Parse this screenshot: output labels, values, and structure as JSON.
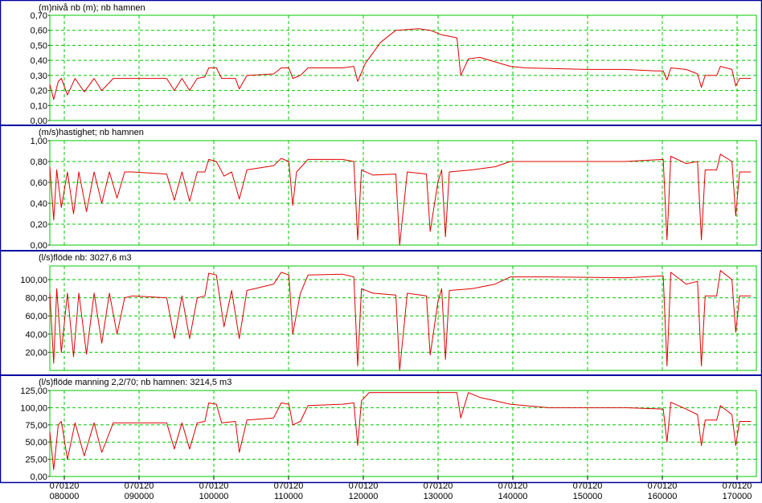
{
  "colors": {
    "frame": "#0000a0",
    "plot_border": "#00c800",
    "grid": "#00c800",
    "trace": "#e00000",
    "background": "#ffffff"
  },
  "time_axis": {
    "ticks": [
      {
        "date": "070120",
        "time": "080000"
      },
      {
        "date": "070120",
        "time": "090000"
      },
      {
        "date": "070120",
        "time": "100000"
      },
      {
        "date": "070120",
        "time": "110000"
      },
      {
        "date": "070120",
        "time": "120000"
      },
      {
        "date": "070120",
        "time": "130000"
      },
      {
        "date": "070120",
        "time": "140000"
      },
      {
        "date": "070120",
        "time": "150000"
      },
      {
        "date": "070120",
        "time": "160000"
      },
      {
        "date": "070120",
        "time": "170000"
      }
    ]
  },
  "chart_data": [
    {
      "type": "line",
      "title": "(m)nivå nb (m); nb hamnen",
      "ylim": [
        0,
        0.7
      ],
      "yticks": [
        "0,00",
        "0,10",
        "0,20",
        "0,30",
        "0,40",
        "0,50",
        "0,60",
        "0,70"
      ],
      "grid": true,
      "x_unit": "hour of day (070120)",
      "points": [
        [
          7.97,
          0.24
        ],
        [
          8.02,
          0.14
        ],
        [
          8.08,
          0.26
        ],
        [
          8.12,
          0.28
        ],
        [
          8.2,
          0.17
        ],
        [
          8.3,
          0.28
        ],
        [
          8.42,
          0.19
        ],
        [
          8.55,
          0.28
        ],
        [
          8.65,
          0.2
        ],
        [
          8.8,
          0.28
        ],
        [
          8.95,
          0.28
        ],
        [
          9.0,
          0.28
        ],
        [
          9.5,
          0.28
        ],
        [
          9.6,
          0.2
        ],
        [
          9.7,
          0.28
        ],
        [
          9.8,
          0.2
        ],
        [
          9.9,
          0.28
        ],
        [
          10.0,
          0.29
        ],
        [
          10.05,
          0.35
        ],
        [
          10.15,
          0.35
        ],
        [
          10.22,
          0.28
        ],
        [
          10.4,
          0.28
        ],
        [
          10.45,
          0.21
        ],
        [
          10.55,
          0.3
        ],
        [
          10.9,
          0.31
        ],
        [
          11.0,
          0.35
        ],
        [
          11.1,
          0.35
        ],
        [
          11.15,
          0.28
        ],
        [
          11.25,
          0.3
        ],
        [
          11.35,
          0.35
        ],
        [
          11.8,
          0.35
        ],
        [
          11.95,
          0.36
        ],
        [
          12.0,
          0.26
        ],
        [
          12.1,
          0.38
        ],
        [
          12.3,
          0.52
        ],
        [
          12.5,
          0.6
        ],
        [
          12.8,
          0.61
        ],
        [
          12.95,
          0.6
        ],
        [
          13.1,
          0.57
        ],
        [
          13.3,
          0.55
        ],
        [
          13.35,
          0.3
        ],
        [
          13.45,
          0.41
        ],
        [
          13.6,
          0.42
        ],
        [
          13.8,
          0.39
        ],
        [
          14.0,
          0.36
        ],
        [
          14.2,
          0.35
        ],
        [
          15.0,
          0.34
        ],
        [
          15.5,
          0.34
        ],
        [
          15.9,
          0.33
        ],
        [
          16.0,
          0.33
        ],
        [
          16.05,
          0.27
        ],
        [
          16.1,
          0.35
        ],
        [
          16.3,
          0.34
        ],
        [
          16.45,
          0.31
        ],
        [
          16.5,
          0.22
        ],
        [
          16.55,
          0.3
        ],
        [
          16.7,
          0.3
        ],
        [
          16.75,
          0.36
        ],
        [
          16.9,
          0.34
        ],
        [
          16.95,
          0.23
        ],
        [
          17.0,
          0.28
        ],
        [
          17.15,
          0.28
        ]
      ]
    },
    {
      "type": "line",
      "title": "(m/s)hastighet; nb hamnen",
      "ylim": [
        0,
        1.0
      ],
      "yticks": [
        "0,00",
        "0,20",
        "0,40",
        "0,60",
        "0,80",
        "1,00"
      ],
      "grid": true,
      "x_unit": "hour of day (070120)",
      "points": [
        [
          7.97,
          0.75
        ],
        [
          8.02,
          0.24
        ],
        [
          8.06,
          0.72
        ],
        [
          8.12,
          0.36
        ],
        [
          8.2,
          0.7
        ],
        [
          8.28,
          0.3
        ],
        [
          8.35,
          0.7
        ],
        [
          8.45,
          0.32
        ],
        [
          8.55,
          0.7
        ],
        [
          8.65,
          0.4
        ],
        [
          8.75,
          0.7
        ],
        [
          8.85,
          0.45
        ],
        [
          8.95,
          0.7
        ],
        [
          9.05,
          0.7
        ],
        [
          9.5,
          0.68
        ],
        [
          9.6,
          0.43
        ],
        [
          9.7,
          0.7
        ],
        [
          9.8,
          0.42
        ],
        [
          9.9,
          0.7
        ],
        [
          10.0,
          0.7
        ],
        [
          10.05,
          0.82
        ],
        [
          10.15,
          0.8
        ],
        [
          10.25,
          0.66
        ],
        [
          10.35,
          0.7
        ],
        [
          10.45,
          0.44
        ],
        [
          10.55,
          0.72
        ],
        [
          10.9,
          0.76
        ],
        [
          11.0,
          0.83
        ],
        [
          11.1,
          0.8
        ],
        [
          11.15,
          0.38
        ],
        [
          11.2,
          0.7
        ],
        [
          11.35,
          0.82
        ],
        [
          11.8,
          0.82
        ],
        [
          11.95,
          0.8
        ],
        [
          12.0,
          0.05
        ],
        [
          12.05,
          0.72
        ],
        [
          12.2,
          0.67
        ],
        [
          12.5,
          0.68
        ],
        [
          12.55,
          0.0
        ],
        [
          12.65,
          0.7
        ],
        [
          12.9,
          0.68
        ],
        [
          12.95,
          0.13
        ],
        [
          13.05,
          0.6
        ],
        [
          13.1,
          0.72
        ],
        [
          13.15,
          0.08
        ],
        [
          13.2,
          0.7
        ],
        [
          13.5,
          0.72
        ],
        [
          13.8,
          0.75
        ],
        [
          14.0,
          0.8
        ],
        [
          14.5,
          0.8
        ],
        [
          15.5,
          0.8
        ],
        [
          16.0,
          0.82
        ],
        [
          16.05,
          0.05
        ],
        [
          16.1,
          0.85
        ],
        [
          16.3,
          0.78
        ],
        [
          16.45,
          0.8
        ],
        [
          16.5,
          0.05
        ],
        [
          16.55,
          0.72
        ],
        [
          16.7,
          0.72
        ],
        [
          16.75,
          0.87
        ],
        [
          16.9,
          0.8
        ],
        [
          16.95,
          0.28
        ],
        [
          17.0,
          0.7
        ],
        [
          17.15,
          0.7
        ]
      ]
    },
    {
      "type": "line",
      "title": "(l/s)flöde nb: 3027,6 m3",
      "ylim": [
        0,
        115
      ],
      "yticks": [
        "20,00",
        "40,00",
        "60,00",
        "80,00",
        "100,00"
      ],
      "grid": true,
      "x_unit": "hour of day (070120)",
      "points": [
        [
          7.97,
          85
        ],
        [
          8.02,
          8
        ],
        [
          8.06,
          90
        ],
        [
          8.12,
          20
        ],
        [
          8.2,
          85
        ],
        [
          8.28,
          15
        ],
        [
          8.35,
          85
        ],
        [
          8.45,
          18
        ],
        [
          8.55,
          85
        ],
        [
          8.65,
          30
        ],
        [
          8.75,
          85
        ],
        [
          8.85,
          40
        ],
        [
          8.95,
          80
        ],
        [
          9.05,
          82
        ],
        [
          9.5,
          80
        ],
        [
          9.6,
          35
        ],
        [
          9.7,
          82
        ],
        [
          9.8,
          35
        ],
        [
          9.9,
          80
        ],
        [
          10.0,
          82
        ],
        [
          10.05,
          107
        ],
        [
          10.15,
          105
        ],
        [
          10.25,
          48
        ],
        [
          10.35,
          88
        ],
        [
          10.45,
          35
        ],
        [
          10.55,
          88
        ],
        [
          10.9,
          95
        ],
        [
          11.0,
          108
        ],
        [
          11.1,
          105
        ],
        [
          11.15,
          40
        ],
        [
          11.25,
          85
        ],
        [
          11.35,
          105
        ],
        [
          11.8,
          106
        ],
        [
          11.95,
          103
        ],
        [
          12.0,
          5
        ],
        [
          12.05,
          90
        ],
        [
          12.2,
          85
        ],
        [
          12.5,
          83
        ],
        [
          12.55,
          0
        ],
        [
          12.65,
          85
        ],
        [
          12.9,
          82
        ],
        [
          12.95,
          17
        ],
        [
          13.05,
          75
        ],
        [
          13.1,
          90
        ],
        [
          13.15,
          12
        ],
        [
          13.2,
          88
        ],
        [
          13.5,
          90
        ],
        [
          13.8,
          95
        ],
        [
          14.0,
          103
        ],
        [
          14.5,
          103
        ],
        [
          15.5,
          102
        ],
        [
          16.0,
          104
        ],
        [
          16.05,
          5
        ],
        [
          16.1,
          108
        ],
        [
          16.3,
          95
        ],
        [
          16.45,
          98
        ],
        [
          16.5,
          5
        ],
        [
          16.55,
          82
        ],
        [
          16.7,
          82
        ],
        [
          16.75,
          110
        ],
        [
          16.9,
          100
        ],
        [
          16.95,
          42
        ],
        [
          17.0,
          82
        ],
        [
          17.15,
          82
        ]
      ]
    },
    {
      "type": "line",
      "title": "(l/s)flöde manning 2,2/70; nb hamnen: 3214,5 m3",
      "ylim": [
        0,
        125
      ],
      "yticks": [
        "0,00",
        "25,00",
        "50,00",
        "75,00",
        "100,00",
        "125,00"
      ],
      "grid": true,
      "x_unit": "hour of day (070120)",
      "points": [
        [
          7.97,
          65
        ],
        [
          8.02,
          10
        ],
        [
          8.08,
          75
        ],
        [
          8.12,
          80
        ],
        [
          8.2,
          25
        ],
        [
          8.3,
          78
        ],
        [
          8.42,
          30
        ],
        [
          8.55,
          78
        ],
        [
          8.65,
          35
        ],
        [
          8.8,
          78
        ],
        [
          8.95,
          78
        ],
        [
          9.0,
          78
        ],
        [
          9.5,
          78
        ],
        [
          9.6,
          40
        ],
        [
          9.7,
          78
        ],
        [
          9.8,
          40
        ],
        [
          9.9,
          78
        ],
        [
          10.0,
          80
        ],
        [
          10.05,
          107
        ],
        [
          10.15,
          105
        ],
        [
          10.22,
          78
        ],
        [
          10.4,
          80
        ],
        [
          10.45,
          35
        ],
        [
          10.55,
          82
        ],
        [
          10.9,
          85
        ],
        [
          11.0,
          107
        ],
        [
          11.1,
          105
        ],
        [
          11.15,
          75
        ],
        [
          11.25,
          80
        ],
        [
          11.35,
          103
        ],
        [
          11.8,
          105
        ],
        [
          11.95,
          107
        ],
        [
          12.0,
          45
        ],
        [
          12.05,
          110
        ],
        [
          12.15,
          122
        ],
        [
          13.3,
          122
        ],
        [
          13.35,
          85
        ],
        [
          13.45,
          122
        ],
        [
          13.6,
          115
        ],
        [
          13.8,
          110
        ],
        [
          14.0,
          105
        ],
        [
          14.5,
          100
        ],
        [
          15.5,
          100
        ],
        [
          16.0,
          98
        ],
        [
          16.05,
          50
        ],
        [
          16.1,
          108
        ],
        [
          16.3,
          98
        ],
        [
          16.45,
          90
        ],
        [
          16.5,
          45
        ],
        [
          16.55,
          82
        ],
        [
          16.7,
          82
        ],
        [
          16.75,
          103
        ],
        [
          16.9,
          90
        ],
        [
          16.95,
          45
        ],
        [
          17.0,
          80
        ],
        [
          17.15,
          80
        ]
      ]
    }
  ]
}
